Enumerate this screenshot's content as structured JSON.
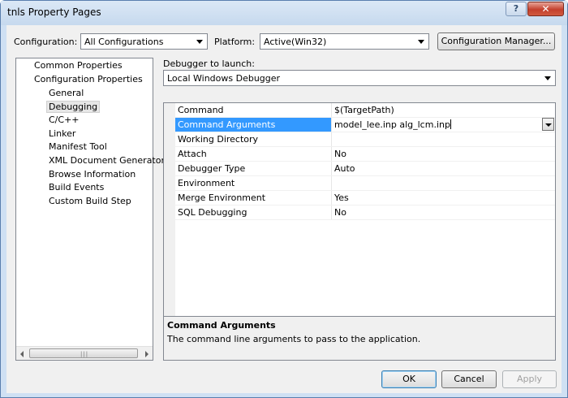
{
  "window": {
    "title": "tnls Property Pages",
    "help_glyph": "?",
    "close_glyph": "✕"
  },
  "toolbar": {
    "configuration_label": "Configuration:",
    "configuration_value": "All Configurations",
    "platform_label": "Platform:",
    "platform_value": "Active(Win32)",
    "config_manager_label": "Configuration Manager..."
  },
  "tree": {
    "items": [
      {
        "label": "Common Properties"
      },
      {
        "label": "Configuration Properties"
      },
      {
        "label": "General"
      },
      {
        "label": "Debugging",
        "selected": true
      },
      {
        "label": "C/C++"
      },
      {
        "label": "Linker"
      },
      {
        "label": "Manifest Tool"
      },
      {
        "label": "XML Document Generator"
      },
      {
        "label": "Browse Information"
      },
      {
        "label": "Build Events"
      },
      {
        "label": "Custom Build Step"
      }
    ]
  },
  "debugger": {
    "label": "Debugger to launch:",
    "value": "Local Windows Debugger"
  },
  "properties": {
    "rows": [
      {
        "name": "Command",
        "value": "$(TargetPath)"
      },
      {
        "name": "Command Arguments",
        "value": "model_lee.inp alg_lcm.inp",
        "selected": true
      },
      {
        "name": "Working Directory",
        "value": ""
      },
      {
        "name": "Attach",
        "value": "No"
      },
      {
        "name": "Debugger Type",
        "value": "Auto"
      },
      {
        "name": "Environment",
        "value": ""
      },
      {
        "name": "Merge Environment",
        "value": "Yes"
      },
      {
        "name": "SQL Debugging",
        "value": "No"
      }
    ]
  },
  "description": {
    "title": "Command Arguments",
    "text": "The command line arguments to pass to the application."
  },
  "buttons": {
    "ok": "OK",
    "cancel": "Cancel",
    "apply": "Apply"
  },
  "colors": {
    "selection": "#3399ff",
    "titlebar": "#cfe0f3",
    "close_button": "#c4402d"
  }
}
